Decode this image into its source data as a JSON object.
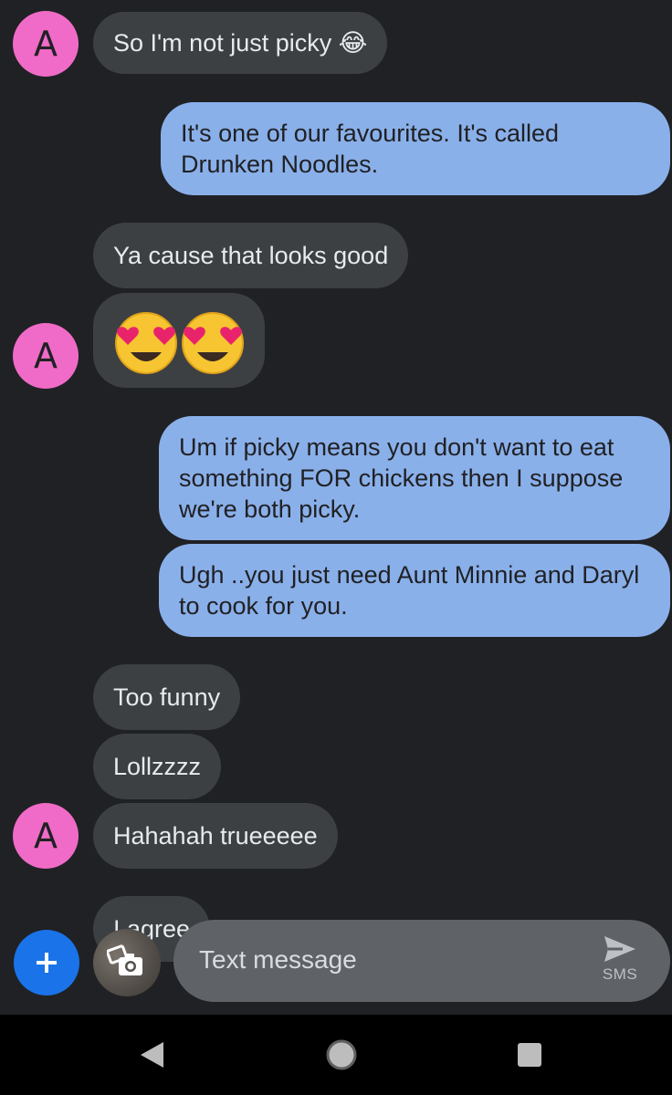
{
  "contact": {
    "initial": "A",
    "avatar_color": "#f06bc7"
  },
  "messages": [
    {
      "dir": "in",
      "text": "So I'm not just picky 😂"
    },
    {
      "dir": "out",
      "text": "It's one of our favourites. It's called Drunken Noodles."
    },
    {
      "dir": "in",
      "text": "Ya cause that looks good"
    },
    {
      "dir": "in",
      "text": "😍😍"
    },
    {
      "dir": "out",
      "text": "Um if picky means you don't want to eat something FOR chickens then I suppose we're both picky."
    },
    {
      "dir": "out",
      "text": "Ugh ..you just need Aunt Minnie and Daryl to cook for you."
    },
    {
      "dir": "in",
      "text": "Too funny"
    },
    {
      "dir": "in",
      "text": "Lollzzzz"
    },
    {
      "dir": "in",
      "text": "Hahahah trueeeee"
    },
    {
      "dir": "in",
      "text": "I agree"
    }
  ],
  "compose": {
    "placeholder": "Text message",
    "send_label": "SMS",
    "add_icon": "plus-icon",
    "attach_icon": "camera-gallery-icon"
  },
  "navbar": {
    "back_icon": "back-triangle-icon",
    "home_icon": "home-circle-icon",
    "recents_icon": "recents-square-icon"
  },
  "colors": {
    "background": "#202124",
    "incoming": "#3c4043",
    "outgoing": "#8ab0ea",
    "accent": "#1a73e8"
  }
}
